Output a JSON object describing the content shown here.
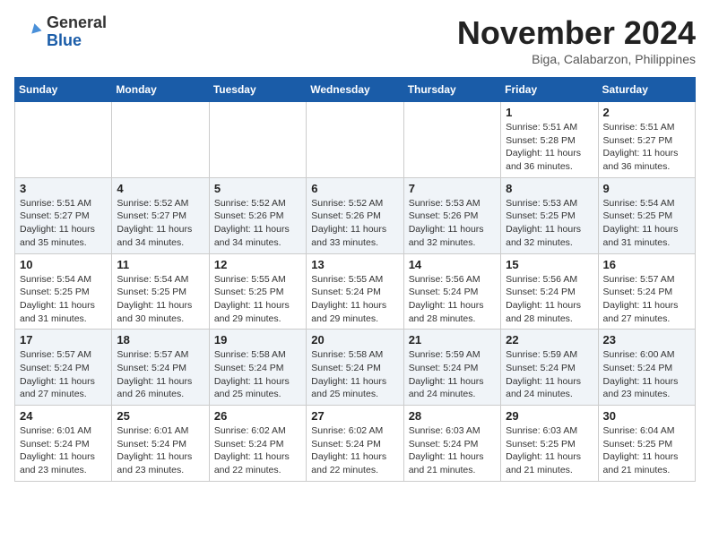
{
  "logo": {
    "general": "General",
    "blue": "Blue"
  },
  "header": {
    "month_year": "November 2024",
    "location": "Biga, Calabarzon, Philippines"
  },
  "weekdays": [
    "Sunday",
    "Monday",
    "Tuesday",
    "Wednesday",
    "Thursday",
    "Friday",
    "Saturday"
  ],
  "weeks": [
    [
      {
        "day": "",
        "info": ""
      },
      {
        "day": "",
        "info": ""
      },
      {
        "day": "",
        "info": ""
      },
      {
        "day": "",
        "info": ""
      },
      {
        "day": "",
        "info": ""
      },
      {
        "day": "1",
        "info": "Sunrise: 5:51 AM\nSunset: 5:28 PM\nDaylight: 11 hours and 36 minutes."
      },
      {
        "day": "2",
        "info": "Sunrise: 5:51 AM\nSunset: 5:27 PM\nDaylight: 11 hours and 36 minutes."
      }
    ],
    [
      {
        "day": "3",
        "info": "Sunrise: 5:51 AM\nSunset: 5:27 PM\nDaylight: 11 hours and 35 minutes."
      },
      {
        "day": "4",
        "info": "Sunrise: 5:52 AM\nSunset: 5:27 PM\nDaylight: 11 hours and 34 minutes."
      },
      {
        "day": "5",
        "info": "Sunrise: 5:52 AM\nSunset: 5:26 PM\nDaylight: 11 hours and 34 minutes."
      },
      {
        "day": "6",
        "info": "Sunrise: 5:52 AM\nSunset: 5:26 PM\nDaylight: 11 hours and 33 minutes."
      },
      {
        "day": "7",
        "info": "Sunrise: 5:53 AM\nSunset: 5:26 PM\nDaylight: 11 hours and 32 minutes."
      },
      {
        "day": "8",
        "info": "Sunrise: 5:53 AM\nSunset: 5:25 PM\nDaylight: 11 hours and 32 minutes."
      },
      {
        "day": "9",
        "info": "Sunrise: 5:54 AM\nSunset: 5:25 PM\nDaylight: 11 hours and 31 minutes."
      }
    ],
    [
      {
        "day": "10",
        "info": "Sunrise: 5:54 AM\nSunset: 5:25 PM\nDaylight: 11 hours and 31 minutes."
      },
      {
        "day": "11",
        "info": "Sunrise: 5:54 AM\nSunset: 5:25 PM\nDaylight: 11 hours and 30 minutes."
      },
      {
        "day": "12",
        "info": "Sunrise: 5:55 AM\nSunset: 5:25 PM\nDaylight: 11 hours and 29 minutes."
      },
      {
        "day": "13",
        "info": "Sunrise: 5:55 AM\nSunset: 5:24 PM\nDaylight: 11 hours and 29 minutes."
      },
      {
        "day": "14",
        "info": "Sunrise: 5:56 AM\nSunset: 5:24 PM\nDaylight: 11 hours and 28 minutes."
      },
      {
        "day": "15",
        "info": "Sunrise: 5:56 AM\nSunset: 5:24 PM\nDaylight: 11 hours and 28 minutes."
      },
      {
        "day": "16",
        "info": "Sunrise: 5:57 AM\nSunset: 5:24 PM\nDaylight: 11 hours and 27 minutes."
      }
    ],
    [
      {
        "day": "17",
        "info": "Sunrise: 5:57 AM\nSunset: 5:24 PM\nDaylight: 11 hours and 27 minutes."
      },
      {
        "day": "18",
        "info": "Sunrise: 5:57 AM\nSunset: 5:24 PM\nDaylight: 11 hours and 26 minutes."
      },
      {
        "day": "19",
        "info": "Sunrise: 5:58 AM\nSunset: 5:24 PM\nDaylight: 11 hours and 25 minutes."
      },
      {
        "day": "20",
        "info": "Sunrise: 5:58 AM\nSunset: 5:24 PM\nDaylight: 11 hours and 25 minutes."
      },
      {
        "day": "21",
        "info": "Sunrise: 5:59 AM\nSunset: 5:24 PM\nDaylight: 11 hours and 24 minutes."
      },
      {
        "day": "22",
        "info": "Sunrise: 5:59 AM\nSunset: 5:24 PM\nDaylight: 11 hours and 24 minutes."
      },
      {
        "day": "23",
        "info": "Sunrise: 6:00 AM\nSunset: 5:24 PM\nDaylight: 11 hours and 23 minutes."
      }
    ],
    [
      {
        "day": "24",
        "info": "Sunrise: 6:01 AM\nSunset: 5:24 PM\nDaylight: 11 hours and 23 minutes."
      },
      {
        "day": "25",
        "info": "Sunrise: 6:01 AM\nSunset: 5:24 PM\nDaylight: 11 hours and 23 minutes."
      },
      {
        "day": "26",
        "info": "Sunrise: 6:02 AM\nSunset: 5:24 PM\nDaylight: 11 hours and 22 minutes."
      },
      {
        "day": "27",
        "info": "Sunrise: 6:02 AM\nSunset: 5:24 PM\nDaylight: 11 hours and 22 minutes."
      },
      {
        "day": "28",
        "info": "Sunrise: 6:03 AM\nSunset: 5:24 PM\nDaylight: 11 hours and 21 minutes."
      },
      {
        "day": "29",
        "info": "Sunrise: 6:03 AM\nSunset: 5:25 PM\nDaylight: 11 hours and 21 minutes."
      },
      {
        "day": "30",
        "info": "Sunrise: 6:04 AM\nSunset: 5:25 PM\nDaylight: 11 hours and 21 minutes."
      }
    ]
  ]
}
